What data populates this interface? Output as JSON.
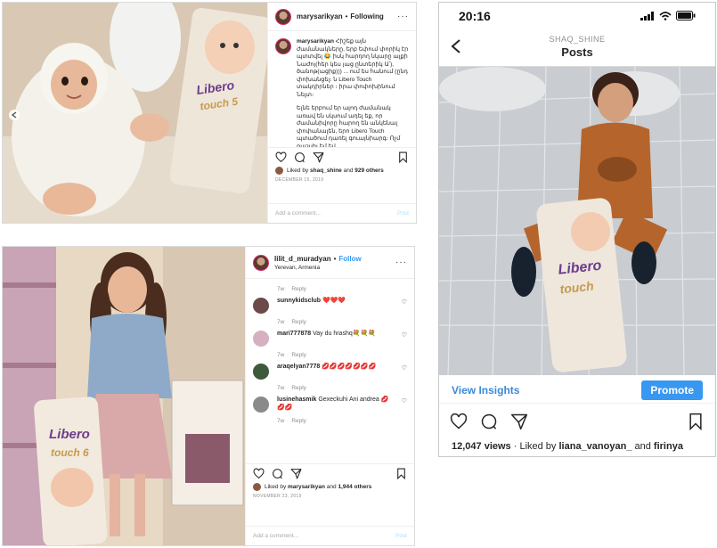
{
  "post1": {
    "username": "marysarikyan",
    "follow_label": "Following",
    "caption_username": "marysarikyan",
    "caption_p1": "Հիշեք այն ժամանակները, երբ եփում փորիկ էր պտտվել 😂 իսկ հարդող նկարը ալքի Նաժոյ(հեր կես յաց ընտերիկ Ա՛), ծանոթ(ացիք))) ... ում ես հանում (ընդ փոխանցել։ ն Libero Touch տակդիրներ ։ իրա փոփոխինում Նելտ։",
    "caption_p2": "Ելնե երբում եր ալոդ ժամանակ առավ են սկսում ադել եք, որ ժամանիվորը հարող են անկենալ փոփանալեն, երո Libero Touch պտածում դառել գուայնիարգ։ Ոչմ ռաշսիլ եմ եվ",
    "likes_prefix": "Liked by",
    "liked_by": "shaq_shine",
    "and": "and",
    "others": "929 others",
    "date": "DECEMBER 15, 2019",
    "add_comment": "Add a comment...",
    "post_label": "Post",
    "package_brand": "Libero",
    "package_line": "touch 5"
  },
  "post2": {
    "username": "lilit_d_muradyan",
    "follow_label": "Follow",
    "location": "Yerevan, Armenia",
    "comments": [
      {
        "time": "7w",
        "reply": "Reply"
      },
      {
        "user": "sunnykidsclub",
        "text": "❤️❤️❤️",
        "time": "7w",
        "reply": "Reply"
      },
      {
        "user": "mari777878",
        "text": "Vay du hrashq💐💐💐",
        "time": "7w",
        "reply": "Reply"
      },
      {
        "user": "araqelyan7778",
        "text": "💋💋💋💋💋💋💋",
        "time": "7w",
        "reply": "Reply"
      },
      {
        "user": "lusinehasmik",
        "text": "Gexeckuhi Ani andrea 💋💋💋",
        "time": "7w",
        "reply": "Reply"
      }
    ],
    "likes_prefix": "Liked by",
    "liked_by": "marysarikyan",
    "and": "and",
    "others": "1,944 others",
    "date": "NOVEMBER 23, 2019",
    "add_comment": "Add a comment...",
    "post_label": "Post",
    "package_brand": "Libero",
    "package_line": "touch 6"
  },
  "post3": {
    "time": "20:16",
    "account": "SHAQ_SHINE",
    "title": "Posts",
    "view_insights": "View Insights",
    "promote": "Promote",
    "views": "12,047 views",
    "liked_by_prefix": "· Liked by",
    "liked_by": "liana_vanoyan_",
    "and": "and",
    "others": "firinya",
    "package_brand": "Libero",
    "package_line": "touch"
  }
}
